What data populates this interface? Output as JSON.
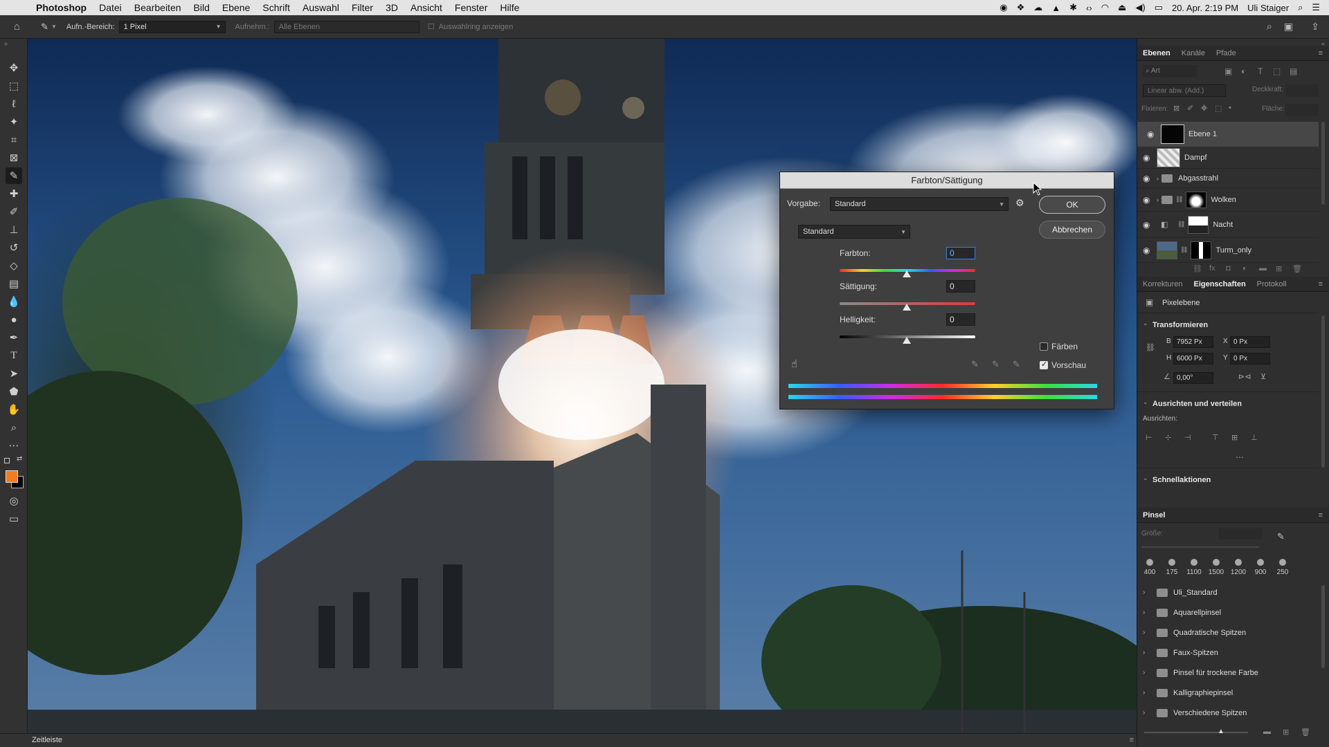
{
  "menubar": {
    "app": "Photoshop",
    "items": [
      "Datei",
      "Bearbeiten",
      "Bild",
      "Ebene",
      "Schrift",
      "Auswahl",
      "Filter",
      "3D",
      "Ansicht",
      "Fenster",
      "Hilfe"
    ],
    "datetime": "20. Apr. 2:19 PM",
    "user": "Uli Staiger"
  },
  "options": {
    "sample_label": "Aufn.-Bereich:",
    "sample_value": "1 Pixel",
    "sample_layers_label": "Aufnehm.:",
    "sample_layers_value": "Alle Ebenen",
    "show_ring": "Auswahlring anzeigen"
  },
  "layers_panel": {
    "tabs": [
      "Ebenen",
      "Kanäle",
      "Pfade"
    ],
    "search_placeholder": "Art",
    "blend_mode": "Linear abw. (Add.)",
    "opacity_label": "Deckkraft:",
    "lock_label": "Fixieren:",
    "fill_label": "Fläche:",
    "layers": [
      {
        "name": "Ebene 1",
        "type": "pixel",
        "selected": true
      },
      {
        "name": "Dampf",
        "type": "pixel",
        "selected": false
      },
      {
        "name": "Abgasstrahl",
        "type": "group",
        "selected": false
      },
      {
        "name": "Wolken",
        "type": "group-mask",
        "selected": false
      },
      {
        "name": "Nacht",
        "type": "adjust-mask",
        "selected": false
      },
      {
        "name": "Turm_only",
        "type": "pixel-mask",
        "selected": false
      }
    ]
  },
  "properties_panel": {
    "tabs": [
      "Korrekturen",
      "Eigenschaften",
      "Protokoll"
    ],
    "layer_kind": "Pixelebene",
    "transform_title": "Transformieren",
    "w_label": "B",
    "w": "7952 Px",
    "h_label": "H",
    "h": "6000 Px",
    "x_label": "X",
    "x": "0 Px",
    "y_label": "Y",
    "y": "0 Px",
    "angle": "0,00°",
    "align_title": "Ausrichten und verteilen",
    "align_label": "Ausrichten:",
    "quick_title": "Schnellaktionen"
  },
  "brush_panel": {
    "title": "Pinsel",
    "size_label": "Größe:",
    "presets": [
      "400",
      "175",
      "1100",
      "1500",
      "1200",
      "900",
      "250"
    ],
    "groups": [
      "Uli_Standard",
      "Aquarellpinsel",
      "Quadratische Spitzen",
      "Faux-Spitzen",
      "Pinsel für trockene Farbe",
      "Kalligraphiepinsel",
      "Verschiedene Spitzen"
    ]
  },
  "timeline": {
    "label": "Zeitleiste"
  },
  "dialog": {
    "title": "Farbton/Sättigung",
    "preset_label": "Vorgabe:",
    "preset_value": "Standard",
    "channel_value": "Standard",
    "ok": "OK",
    "cancel": "Abbrechen",
    "hue_label": "Farbton:",
    "hue_value": "0",
    "sat_label": "Sättigung:",
    "sat_value": "0",
    "light_label": "Helligkeit:",
    "light_value": "0",
    "colorize_label": "Färben",
    "colorize_checked": false,
    "preview_label": "Vorschau",
    "preview_checked": true
  },
  "colors": {
    "foreground": "#f07d22",
    "background": "#000000",
    "accent": "#3d7fd8"
  }
}
